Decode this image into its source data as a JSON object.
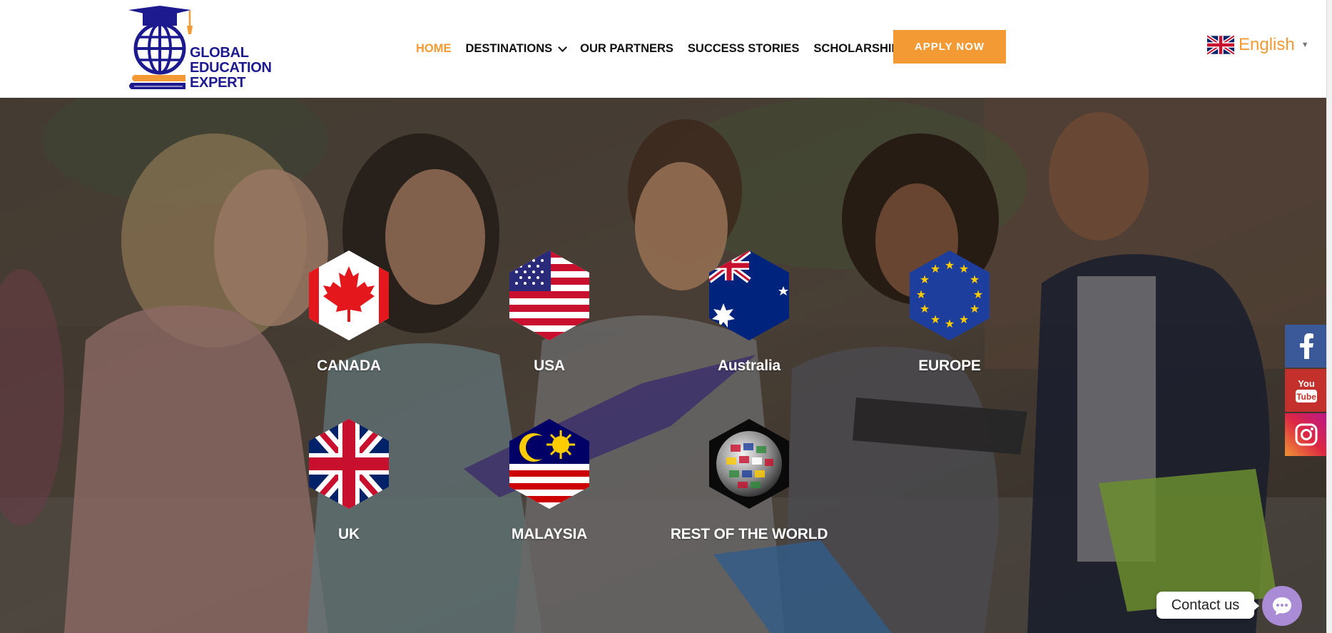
{
  "brand": {
    "lines": [
      "GLOBAL",
      "EDUCATION",
      "EXPERT"
    ],
    "primary_color": "#1c1a8e",
    "accent_color": "#f39a34",
    "icon": "graduation-globe-logo"
  },
  "nav": {
    "items": [
      {
        "label": "HOME",
        "active": true
      },
      {
        "label": "DESTINATIONS",
        "has_dropdown": true
      },
      {
        "label": "OUR PARTNERS"
      },
      {
        "label": "SUCCESS STORIES"
      },
      {
        "label": "SCHOLARSHIPS"
      }
    ],
    "apply_label": "APPLY NOW"
  },
  "language": {
    "selected": "English",
    "flag": "uk-flag-icon"
  },
  "destinations": [
    {
      "label": "CANADA",
      "flag": "canada-flag-icon"
    },
    {
      "label": "USA",
      "flag": "usa-flag-icon"
    },
    {
      "label": "Australia",
      "flag": "australia-flag-icon"
    },
    {
      "label": "EUROPE",
      "flag": "eu-flag-icon"
    },
    {
      "label": "UK",
      "flag": "uk-flag-icon"
    },
    {
      "label": "MALAYSIA",
      "flag": "malaysia-flag-icon"
    },
    {
      "label": "REST OF THE WORLD",
      "flag": "world-globe-icon"
    }
  ],
  "social": [
    {
      "name": "facebook",
      "icon": "facebook-icon",
      "color": "#3b5998"
    },
    {
      "name": "youtube",
      "icon": "youtube-icon",
      "color": "#c4302b"
    },
    {
      "name": "instagram",
      "icon": "instagram-icon",
      "color": "#e1306c"
    }
  ],
  "contact": {
    "label": "Contact us",
    "icon": "chat-bubble-icon",
    "color": "#a98bd6"
  }
}
